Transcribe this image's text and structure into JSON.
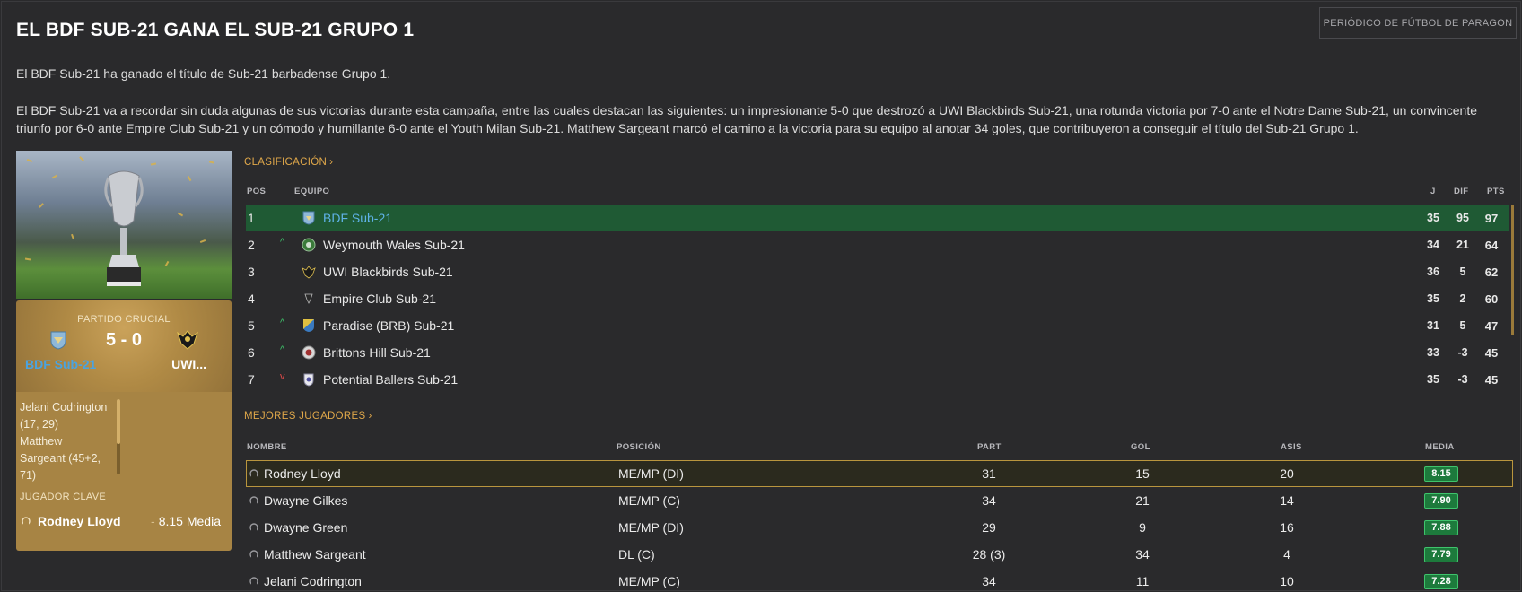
{
  "headline": "EL BDF SUB-21 GANA EL SUB-21 GRUPO 1",
  "publisher": "PERIÓDICO DE FÚTBOL DE PARAGON",
  "intro": "El BDF Sub-21 ha ganado el título de Sub-21 barbadense Grupo 1.",
  "body": "El BDF Sub-21 va a recordar sin duda algunas de sus victorias durante esta campaña, entre las cuales destacan las siguientes: un impresionante 5-0 que destrozó a UWI Blackbirds Sub-21, una rotunda victoria por 7-0 ante el Notre Dame Sub-21, un convincente triunfo por 6-0 ante Empire Club Sub-21 y un cómodo y humillante 6-0 ante el Youth Milan Sub-21. Matthew Sargeant marcó el camino a la victoria para su equipo al anotar 34 goles, que contribuyeron a conseguir el título del Sub-21 Grupo 1.",
  "crucial_match": {
    "label": "PARTIDO CRUCIAL",
    "score": "5 - 0",
    "home": "BDF Sub-21",
    "away": "UWI..."
  },
  "scorers": {
    "line1": "Jelani Codrington",
    "line2": "(17, 29)",
    "line3": "Matthew",
    "line4": "Sargeant (45+2,",
    "line5": "71)"
  },
  "key_player": {
    "label": "JUGADOR CLAVE",
    "name": "Rodney Lloyd",
    "rating": "8.15 Media"
  },
  "standings": {
    "link": "CLASIFICACIÓN",
    "headers": {
      "pos": "POS",
      "team": "EQUIPO",
      "j": "J",
      "dif": "DIF",
      "pts": "PTS"
    },
    "rows": [
      {
        "pos": "1",
        "trend": "",
        "team": "BDF Sub-21",
        "j": "35",
        "dif": "95",
        "pts": "97"
      },
      {
        "pos": "2",
        "trend": "^",
        "team": "Weymouth Wales Sub-21",
        "j": "34",
        "dif": "21",
        "pts": "64"
      },
      {
        "pos": "3",
        "trend": "",
        "team": "UWI Blackbirds Sub-21",
        "j": "36",
        "dif": "5",
        "pts": "62"
      },
      {
        "pos": "4",
        "trend": "",
        "team": "Empire Club Sub-21",
        "j": "35",
        "dif": "2",
        "pts": "60"
      },
      {
        "pos": "5",
        "trend": "^",
        "team": "Paradise (BRB) Sub-21",
        "j": "31",
        "dif": "5",
        "pts": "47"
      },
      {
        "pos": "6",
        "trend": "^",
        "team": "Brittons Hill Sub-21",
        "j": "33",
        "dif": "-3",
        "pts": "45"
      },
      {
        "pos": "7",
        "trend": "v",
        "team": "Potential Ballers Sub-21",
        "j": "35",
        "dif": "-3",
        "pts": "45"
      }
    ]
  },
  "players": {
    "link": "MEJORES JUGADORES",
    "headers": {
      "name": "NOMBRE",
      "position": "POSICIÓN",
      "part": "PART",
      "gol": "GOL",
      "asis": "ASIS",
      "media": "MEDIA"
    },
    "rows": [
      {
        "name": "Rodney Lloyd",
        "position": "ME/MP (DI)",
        "part": "31",
        "gol": "15",
        "asis": "20",
        "media": "8.15"
      },
      {
        "name": "Dwayne Gilkes",
        "position": "ME/MP (C)",
        "part": "34",
        "gol": "21",
        "asis": "14",
        "media": "7.90"
      },
      {
        "name": "Dwayne Green",
        "position": "ME/MP (DI)",
        "part": "29",
        "gol": "9",
        "asis": "16",
        "media": "7.88"
      },
      {
        "name": "Matthew Sargeant",
        "position": "DL (C)",
        "part": "28 (3)",
        "gol": "34",
        "asis": "4",
        "media": "7.79"
      },
      {
        "name": "Jelani Codrington",
        "position": "ME/MP (C)",
        "part": "34",
        "gol": "11",
        "asis": "10",
        "media": "7.28"
      }
    ]
  },
  "colors": {
    "accent": "#e0a84a",
    "highlight_row": "#1f5a34",
    "team_link": "#5fb3e8",
    "rating_bg": "#1d7a3c"
  }
}
